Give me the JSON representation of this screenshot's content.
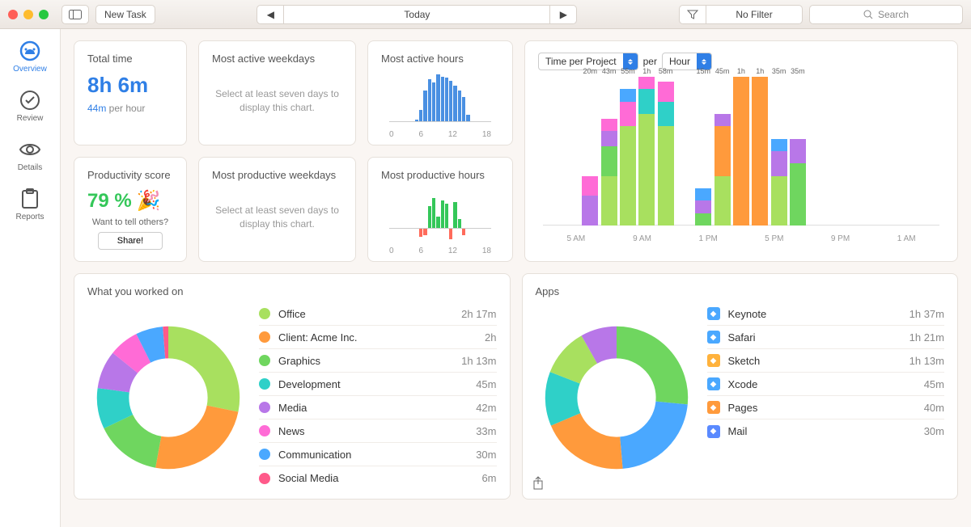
{
  "toolbar": {
    "new_task": "New Task",
    "date_label": "Today",
    "filter_label": "No Filter",
    "search_placeholder": "Search"
  },
  "sidebar": {
    "items": [
      {
        "label": "Overview"
      },
      {
        "label": "Review"
      },
      {
        "label": "Details"
      },
      {
        "label": "Reports"
      }
    ]
  },
  "cards": {
    "total_time": {
      "title": "Total time",
      "value": "8h 6m",
      "rate_value": "44m",
      "rate_suffix": " per hour"
    },
    "active_weekdays": {
      "title": "Most active weekdays",
      "placeholder": "Select at least seven days to display this chart."
    },
    "active_hours": {
      "title": "Most active hours",
      "ticks": [
        "0",
        "6",
        "12",
        "18"
      ]
    },
    "prod_score": {
      "title": "Productivity score",
      "value": "79 %",
      "ask": "Want to tell others?",
      "share": "Share!"
    },
    "prod_weekdays": {
      "title": "Most productive weekdays",
      "placeholder": "Select at least seven days to display this chart."
    },
    "prod_hours": {
      "title": "Most productive hours",
      "ticks": [
        "0",
        "6",
        "12",
        "18"
      ]
    }
  },
  "big_chart": {
    "metric": "Time per Project",
    "per_label": "per",
    "unit": "Hour"
  },
  "worked": {
    "title": "What you worked on",
    "items": [
      {
        "name": "Office",
        "value": "2h 17m",
        "color": "#a8e05f"
      },
      {
        "name": "Client: Acme Inc.",
        "value": "2h",
        "color": "#ff9a3c",
        "expandable": true
      },
      {
        "name": "Graphics",
        "value": "1h 13m",
        "color": "#6fd65f"
      },
      {
        "name": "Development",
        "value": "45m",
        "color": "#2fd0c8"
      },
      {
        "name": "Media",
        "value": "42m",
        "color": "#b877e8"
      },
      {
        "name": "News",
        "value": "33m",
        "color": "#ff6bd6"
      },
      {
        "name": "Communication",
        "value": "30m",
        "color": "#4aa8ff"
      },
      {
        "name": "Social Media",
        "value": "6m",
        "color": "#ff5a8a"
      }
    ]
  },
  "apps": {
    "title": "Apps",
    "items": [
      {
        "name": "Keynote",
        "value": "1h 37m",
        "color": "#4aa8ff"
      },
      {
        "name": "Safari",
        "value": "1h 21m",
        "color": "#4aa8ff"
      },
      {
        "name": "Sketch",
        "value": "1h 13m",
        "color": "#ffb23c"
      },
      {
        "name": "Xcode",
        "value": "45m",
        "color": "#4aa8ff"
      },
      {
        "name": "Pages",
        "value": "40m",
        "color": "#ff9a3c"
      },
      {
        "name": "Mail",
        "value": "30m",
        "color": "#5a8aff"
      }
    ]
  },
  "chart_data": [
    {
      "type": "bar",
      "title": "Most active hours",
      "x": [
        0,
        1,
        2,
        3,
        4,
        5,
        6,
        7,
        8,
        9,
        10,
        11,
        12,
        13,
        14,
        15,
        16,
        17,
        18,
        19,
        20,
        21,
        22,
        23
      ],
      "values": [
        0,
        0,
        0,
        0,
        0,
        0,
        2,
        14,
        38,
        52,
        48,
        58,
        55,
        54,
        50,
        44,
        38,
        30,
        8,
        0,
        0,
        0,
        0,
        0
      ],
      "xlabel": "hour",
      "ylabel": "minutes",
      "ylim": [
        0,
        60
      ]
    },
    {
      "type": "bar",
      "title": "Most productive hours",
      "x": [
        0,
        1,
        2,
        3,
        4,
        5,
        6,
        7,
        8,
        9,
        10,
        11,
        12,
        13,
        14,
        15,
        16,
        17,
        18,
        19,
        20,
        21,
        22,
        23
      ],
      "values": [
        0,
        0,
        0,
        0,
        0,
        0,
        0,
        -10,
        -8,
        24,
        32,
        12,
        30,
        26,
        -12,
        28,
        10,
        -8,
        0,
        0,
        0,
        0,
        0,
        0
      ],
      "xlabel": "hour",
      "ylabel": "score",
      "ylim": [
        -15,
        35
      ]
    },
    {
      "type": "bar",
      "title": "Time per Project per Hour",
      "categories": [
        "5 AM",
        "6 AM",
        "7 AM",
        "8 AM",
        "9 AM",
        "10 AM",
        "11 AM",
        "12 PM",
        "1 PM",
        "2 PM",
        "3 PM",
        "4 PM",
        "5 PM",
        "6 PM",
        "7 PM",
        "8 PM",
        "9 PM",
        "10 PM",
        "11 PM",
        "12 AM",
        "1 AM"
      ],
      "labels": [
        "",
        "",
        "20m",
        "43m",
        "55m",
        "1h",
        "58m",
        "",
        "15m",
        "45m",
        "1h",
        "1h",
        "35m",
        "35m",
        "",
        "",
        "",
        "",
        "",
        "",
        ""
      ],
      "series": [
        {
          "name": "Office",
          "color": "#a8e05f",
          "values": [
            0,
            0,
            0,
            20,
            40,
            45,
            40,
            0,
            0,
            20,
            0,
            0,
            20,
            0,
            0,
            0,
            0,
            0,
            0,
            0,
            0
          ]
        },
        {
          "name": "Client: Acme Inc.",
          "color": "#ff9a3c",
          "values": [
            0,
            0,
            0,
            0,
            0,
            0,
            0,
            0,
            0,
            20,
            60,
            60,
            0,
            0,
            0,
            0,
            0,
            0,
            0,
            0,
            0
          ]
        },
        {
          "name": "Graphics",
          "color": "#6fd65f",
          "values": [
            0,
            0,
            0,
            12,
            0,
            0,
            0,
            0,
            5,
            0,
            0,
            0,
            0,
            25,
            0,
            0,
            0,
            0,
            0,
            0,
            0,
            0
          ]
        },
        {
          "name": "Development",
          "color": "#2fd0c8",
          "values": [
            0,
            0,
            0,
            0,
            0,
            10,
            10,
            0,
            0,
            0,
            0,
            0,
            0,
            0,
            0,
            0,
            0,
            0,
            0,
            0,
            0
          ]
        },
        {
          "name": "Media",
          "color": "#b877e8",
          "values": [
            0,
            0,
            12,
            6,
            0,
            0,
            0,
            0,
            5,
            5,
            0,
            0,
            10,
            10,
            0,
            0,
            0,
            0,
            0,
            0,
            0
          ]
        },
        {
          "name": "News",
          "color": "#ff6bd6",
          "values": [
            0,
            0,
            8,
            5,
            10,
            5,
            8,
            0,
            0,
            0,
            0,
            0,
            0,
            0,
            0,
            0,
            0,
            0,
            0,
            0,
            0
          ]
        },
        {
          "name": "Communication",
          "color": "#4aa8ff",
          "values": [
            0,
            0,
            0,
            0,
            5,
            0,
            0,
            0,
            5,
            0,
            0,
            0,
            5,
            0,
            0,
            0,
            0,
            0,
            0,
            0,
            0
          ]
        },
        {
          "name": "Social Media",
          "color": "#ff5a8a",
          "values": [
            0,
            0,
            0,
            0,
            0,
            0,
            0,
            0,
            0,
            0,
            0,
            0,
            0,
            0,
            0,
            0,
            0,
            0,
            0,
            0,
            0
          ]
        }
      ],
      "ylim": [
        0,
        60
      ],
      "ylabel": "minutes"
    },
    {
      "type": "pie",
      "title": "What you worked on",
      "categories": [
        "Office",
        "Client: Acme Inc.",
        "Graphics",
        "Development",
        "Media",
        "News",
        "Communication",
        "Social Media"
      ],
      "values": [
        137,
        120,
        73,
        45,
        42,
        33,
        30,
        6
      ],
      "colors": [
        "#a8e05f",
        "#ff9a3c",
        "#6fd65f",
        "#2fd0c8",
        "#b877e8",
        "#ff6bd6",
        "#4aa8ff",
        "#ff5a8a"
      ]
    },
    {
      "type": "pie",
      "title": "Apps",
      "categories": [
        "Keynote",
        "Safari",
        "Sketch",
        "Xcode",
        "Pages",
        "Mail"
      ],
      "values": [
        97,
        81,
        73,
        45,
        40,
        30
      ],
      "colors": [
        "#6fd65f",
        "#4aa8ff",
        "#ff9a3c",
        "#2fd0c8",
        "#a8e05f",
        "#b877e8"
      ]
    }
  ]
}
